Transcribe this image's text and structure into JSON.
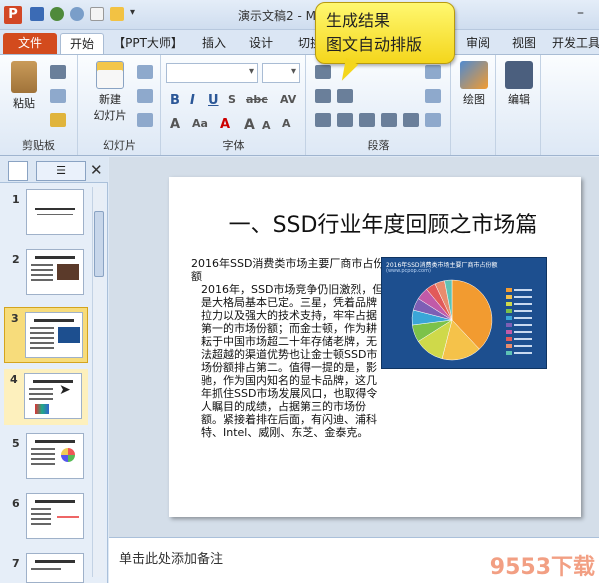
{
  "window": {
    "title": "演示文稿2 - Mi"
  },
  "tabs": {
    "file": "文件",
    "home": "开始",
    "ppt_master": "【PPT大师】",
    "insert": "插入",
    "design": "设计",
    "transition": "切换",
    "review": "审阅",
    "view": "视图",
    "developer": "开发工具"
  },
  "ribbon": {
    "clipboard": {
      "paste": "粘贴",
      "label": "剪贴板"
    },
    "slides": {
      "new_slide_line1": "新建",
      "new_slide_line2": "幻灯片",
      "label": "幻灯片"
    },
    "font": {
      "label": "字体"
    },
    "paragraph": {
      "label": "段落"
    },
    "drawing": {
      "label": "绘图"
    },
    "editing": {
      "label": "编辑"
    }
  },
  "callout": {
    "line1": "生成结果",
    "line2": "图文自动排版"
  },
  "slides_pane": {
    "thumbnails": [
      {
        "num": "1"
      },
      {
        "num": "2"
      },
      {
        "num": "3"
      },
      {
        "num": "4"
      },
      {
        "num": "5"
      },
      {
        "num": "6"
      },
      {
        "num": "7"
      }
    ],
    "selected": "3"
  },
  "slide": {
    "title": "一、SSD行业年度回顾之市场篇",
    "subheading": "2016年SSD消费类市场主要厂商市占份额",
    "paragraph": "2016年，SSD市场竞争仍旧激烈，但是大格局基本已定。三星，凭着品牌拉力以及强大的技术支持，牢牢占据第一的市场份额；而金士顿，作为耕耘于中国市场超二十年存储老牌，无法超越的渠道优势也让金士顿SSD市场份额排占第二。值得一提的是，影驰，作为国内知名的显卡品牌，这几年抓住SSD市场发展风口，也取得令人瞩目的成绩，占据第三的市场份额。紧接着排在后面，有闪迪、浦科特、Intel、威刚、东芝、金泰克。",
    "image": {
      "title": "2016年SSD消费类市场主要厂商市占份额",
      "url_text": "(www.pcpop.com)",
      "slice_colors": [
        "#f29b30",
        "#f5c24a",
        "#cfd94a",
        "#7cc24a",
        "#3aa6d8",
        "#7d5fb5",
        "#c15aa8",
        "#e15a5a",
        "#e88c6d",
        "#5ec2b5"
      ],
      "slice_shares": [
        0.38,
        0.16,
        0.12,
        0.07,
        0.06,
        0.05,
        0.05,
        0.04,
        0.04,
        0.03
      ]
    }
  },
  "notes": {
    "placeholder": "单击此处添加备注"
  },
  "watermark": "9553下载"
}
